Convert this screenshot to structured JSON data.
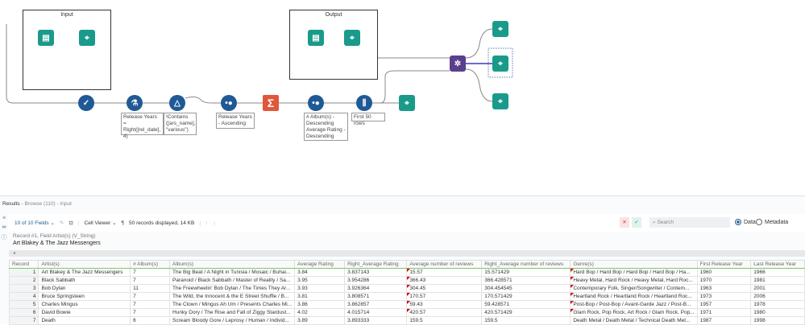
{
  "canvas": {
    "containers": {
      "input": "Input",
      "output": "Output"
    },
    "annotations": {
      "formula": "Release Years = Right([rel_date], 4)",
      "filter": "!Contains ([ars_name], \"various\")",
      "sort1": "Release Years - Ascending",
      "sort2": "# Album(s) - Descending Average Rating - Descending",
      "sample": "First 50 rows"
    }
  },
  "results": {
    "title": "Results",
    "subtitle": "- Browse (110) - Input",
    "fields_label": "10 of 10 Fields",
    "cell_viewer": "Cell Viewer",
    "records_info": "50 records displayed, 14 KB",
    "search_placeholder": "Search",
    "radio_data": "Data",
    "radio_metadata": "Metadata",
    "record_field": "Record #1, Field Artist(s) (V_String)",
    "record_value": "Art Blakey & The Jazz Messengers",
    "columns": [
      "Record",
      "Artist(s)",
      "# Album(s)",
      "Album(s)",
      "Average Rating",
      "Right_Average Rating",
      "Average number of reviews",
      "Right_Average number of reviews",
      "Genre(s)",
      "First Release Year",
      "Last Release Year"
    ],
    "rows": [
      [
        "1",
        "Art Blakey & The Jazz Messengers",
        "7",
        "The Big Beat / A Night in Tunisia / Mosaic / Buhai...",
        "3.84",
        "3.837143",
        "15.57",
        "15.571429",
        "Hard Bop / Hard Bop / Hard Bop / Hard Bop / Ha...",
        "1960",
        "1966"
      ],
      [
        "2",
        "Black Sabbath",
        "7",
        "Paranoid / Black Sabbath / Master of Reality / Sa...",
        "3.95",
        "3.954286",
        "366.43",
        "366.428571",
        "Heavy Metal, Hard Rock / Heavy Metal, Hard Roc...",
        "1970",
        "1981"
      ],
      [
        "3",
        "Bob Dylan",
        "11",
        "The Freewheelin' Bob Dylan / The Times They Ar...",
        "3.93",
        "3.926364",
        "304.45",
        "304.454545",
        "Contemporary Folk, Singer/Songwriter / Contem...",
        "1963",
        "2001"
      ],
      [
        "4",
        "Bruce Springsteen",
        "7",
        "The Wild, the Innocent & the E Street Shuffle / B...",
        "3.81",
        "3.808571",
        "170.57",
        "170.571429",
        "Heartland Rock / Heartland Rock / Heartland Roc...",
        "1973",
        "2006"
      ],
      [
        "5",
        "Charles Mingus",
        "7",
        "The Clown / Mingus Ah Um / Presents Charles Mi...",
        "3.86",
        "3.862857",
        "59.43",
        "59.428571",
        "Post-Bop / Post-Bop / Avant-Garde Jazz / Post-B...",
        "1957",
        "1978"
      ],
      [
        "6",
        "David Bowie",
        "7",
        "Hunky Dory / The Rise and Fall of Ziggy Stardust...",
        "4.02",
        "4.015714",
        "420.57",
        "420.571429",
        "Glam Rock, Pop Rock, Art Rock / Glam Rock, Pop...",
        "1971",
        "1980"
      ],
      [
        "7",
        "Death",
        "6",
        "Scream Bloody Gore / Leprosy / Human / Individ...",
        "3.89",
        "3.893333",
        "159.5",
        "159.5",
        "Death Metal / Death Metal / Technical Death Met...",
        "1987",
        "1998"
      ]
    ]
  }
}
